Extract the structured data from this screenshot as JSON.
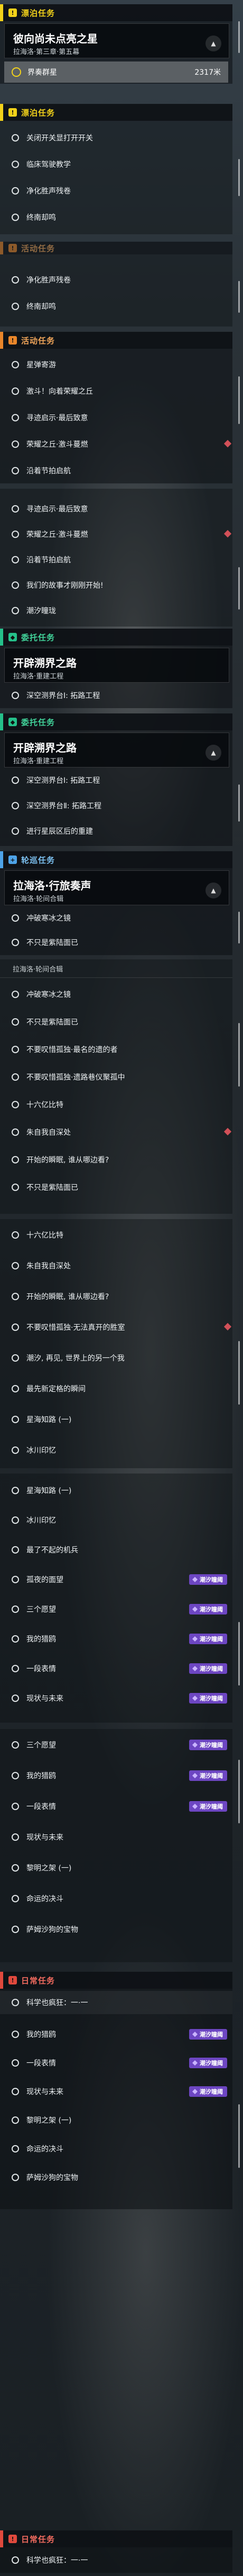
{
  "s1": {
    "section": "漂泊任务",
    "card_title": "彼向尚未点亮之星",
    "card_sub": "拉海洛·第三章·第五幕",
    "tracked_label": "界奏群星",
    "tracked_distance": "2317米"
  },
  "s2": {
    "section": "漂泊任务",
    "items": [
      "关闭开关显打开开关",
      "临床驾驶教学",
      "净化胜声残卷",
      "终南却鸣"
    ]
  },
  "s3": {
    "section": "活动任务",
    "items": [
      "净化胜声残卷",
      "终南却鸣"
    ]
  },
  "s4": {
    "section": "活动任务",
    "items": [
      "星弹寄游",
      "激斗！向着荣耀之丘",
      "寻迹启示·最后致意",
      "荣耀之丘·激斗蔓燃",
      "沿着节拍启航"
    ]
  },
  "s5": {
    "items": [
      "寻迹启示·最后致意",
      "荣耀之丘·激斗蔓燃",
      "沿着节拍启航",
      "我们的故事才刚刚开始!",
      "潮汐瞳珑"
    ]
  },
  "s6": {
    "section": "委托任务",
    "card_title": "开辟溯界之路",
    "card_sub": "拉海洛·重建工程",
    "items": [
      "深空测界台Ⅰ: 拓路工程"
    ]
  },
  "s7": {
    "section": "委托任务",
    "card_title": "开辟溯界之路",
    "card_sub": "拉海洛·重建工程",
    "items": [
      "深空测界台Ⅰ: 拓路工程",
      "深空测界台Ⅱ: 拓路工程",
      "进行星辰区后的重建"
    ]
  },
  "s8": {
    "section": "轮巡任务",
    "card_title": "拉海洛·行旅奏声",
    "card_sub": "拉海洛·轮间合辑",
    "items": [
      "冲破寒冰之镜",
      "不只是紫陆面已"
    ]
  },
  "s9": {
    "sub": "拉海洛·轮间合辑",
    "items": [
      "冲破寒冰之镜",
      "不只是紫陆面已",
      "不要叹惜孤独·最名的遗的者",
      "不要叹惜孤独·遗路巷仪聚孤中",
      "十六亿比特",
      "朱自我自深处",
      "开始的瞬眠, 谁从哪边看?",
      "不只是紫陆面已"
    ]
  },
  "s10": {
    "items": [
      "十六亿比特",
      "朱自我自深处",
      "开始的瞬眠, 谁从哪边看?",
      "不要叹惜孤独·无法真开的胜室",
      "潮汐, 再见, 世界上的另一个我",
      "最先新定格的瞬间",
      "星海知路 (一)",
      "冰川印忆"
    ]
  },
  "s11": {
    "items": [
      "星海知路 (一)",
      "冰川印忆",
      "最了不起的机兵",
      "孤夜的面望",
      "三个愿望",
      "我的猎鸥",
      "一段表情",
      "现状与未来"
    ],
    "badge": "潮汐瞳阈"
  },
  "s12": {
    "items": [
      "三个愿望",
      "我的猎鸥",
      "一段表情",
      "现状与未来",
      "黎明之架 (一)",
      "命运的决斗",
      "萨姆沙狗的宝物"
    ],
    "badge": "潮汐瞳阈"
  },
  "s13": {
    "section": "日常任务",
    "items": [
      "科学也疯狂：一·一",
      "我的猎鸥",
      "一段表情",
      "现状与未来",
      "黎明之架 (一)",
      "命运的决斗",
      "萨姆沙狗的宝物"
    ],
    "badge": "潮汐瞳阈"
  },
  "s14": {
    "section": "日常任务",
    "items": [
      "科学也疯狂：一·一"
    ]
  },
  "colors": {
    "yellow": "#f3d21a",
    "orange": "#e9862a",
    "green": "#25c08a",
    "blue": "#4ea3e8",
    "red": "#e0493d",
    "badge": "#6d46c2",
    "marker": "#d25058"
  },
  "icons": {
    "chevron": "chevron-up-icon",
    "circle": "task-circle-icon",
    "diamond": "track-marker-icon",
    "badge": "tide-badge-icon"
  }
}
